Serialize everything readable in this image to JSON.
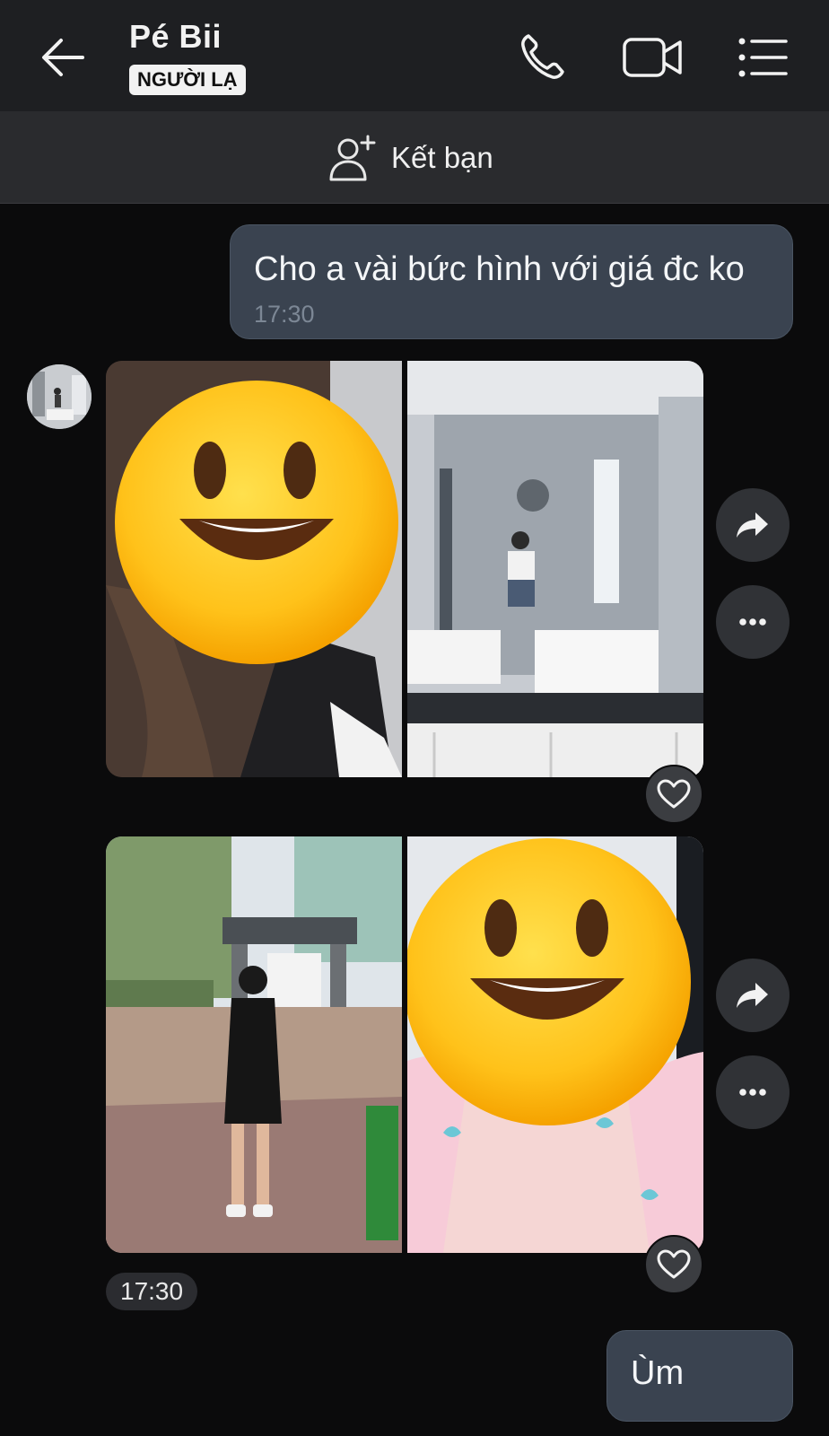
{
  "header": {
    "title": "Pé Bii",
    "badge": "NGƯỜI LẠ",
    "back_icon": "arrow-left-icon",
    "call_icon": "phone-icon",
    "video_icon": "video-camera-icon",
    "menu_icon": "list-menu-icon"
  },
  "friend_bar": {
    "label": "Kết bạn",
    "icon": "add-friend-icon"
  },
  "messages": [
    {
      "direction": "out",
      "text": "Cho a vài bức hình với giá đc ko",
      "time": "17:30"
    },
    {
      "direction": "in",
      "type": "photos",
      "photos": [
        "selfie-with-emoji",
        "bathroom-mirror-selfie"
      ]
    },
    {
      "direction": "in",
      "type": "photos",
      "photos": [
        "outdoor-standing",
        "selfie-with-emoji"
      ],
      "time": "17:30"
    },
    {
      "direction": "out",
      "text": "Ùm"
    }
  ],
  "colors": {
    "background": "#0b0b0c",
    "header": "#1e1f22",
    "outgoing_bubble": "#3a4350",
    "time_text": "#7c8795"
  }
}
